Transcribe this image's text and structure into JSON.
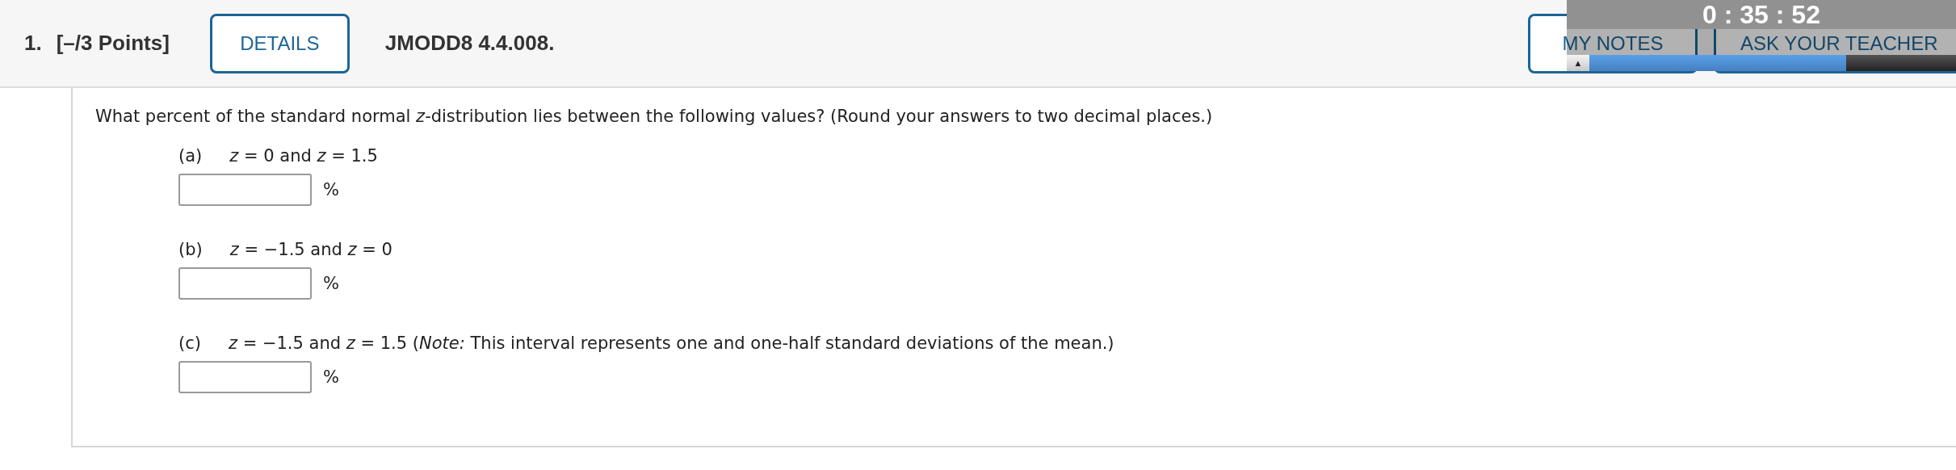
{
  "header": {
    "number": "1.",
    "points": "[–/3 Points]",
    "details_button": "DETAILS",
    "problem_id": "JMODD8 4.4.008.",
    "notes_button": "MY NOTES",
    "teacher_button": "ASK YOUR TEACHER"
  },
  "timer": {
    "text": "0 : 35 : 52",
    "toggle": "▲",
    "level": 0.7
  },
  "question": "What percent of the standard normal *z*-distribution lies between the following values? (Round your answers to two decimal places.)",
  "parts": [
    {
      "label": "(a)",
      "text": "*z* = 0 and *z* = 1.5",
      "unit": "%"
    },
    {
      "label": "(b)",
      "text": "*z* = −1.5 and *z* = 0",
      "unit": "%"
    },
    {
      "label": "(c)",
      "text": "*z* = −1.5 and *z* = 1.5 (*Note:* This interval represents one and one-half standard deviations of the mean.)",
      "unit": "%"
    }
  ]
}
